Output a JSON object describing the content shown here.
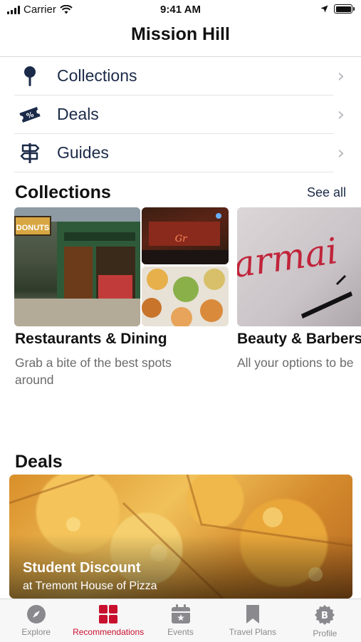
{
  "status": {
    "carrier": "Carrier",
    "time": "9:41 AM"
  },
  "nav": {
    "title": "Mission Hill"
  },
  "menu": [
    {
      "label": "Collections",
      "icon": "pin-icon"
    },
    {
      "label": "Deals",
      "icon": "ticket-icon"
    },
    {
      "label": "Guides",
      "icon": "signpost-icon"
    }
  ],
  "collections": {
    "title": "Collections",
    "see_all": "See all",
    "cards": [
      {
        "title": "Restaurants & Dining",
        "subtitle": "Grab a bite of the best spots around",
        "sign_text": "DONUTS"
      },
      {
        "title": "Beauty & Barbers",
        "subtitle": "All your options to be",
        "sign_text": "armai"
      }
    ]
  },
  "deals": {
    "title": "Deals",
    "card": {
      "title": "Student Discount",
      "subtitle": "at Tremont House of Pizza"
    }
  },
  "tabs": [
    {
      "label": "Explore",
      "icon": "compass-icon",
      "active": false
    },
    {
      "label": "Recommendations",
      "icon": "grid-icon",
      "active": true
    },
    {
      "label": "Events",
      "icon": "calendar-icon",
      "active": false
    },
    {
      "label": "Travel Plans",
      "icon": "bookmark-icon",
      "active": false
    },
    {
      "label": "Profile",
      "icon": "badge-icon",
      "active": false
    }
  ],
  "colors": {
    "accent": "#c8102e",
    "navy": "#1b2a48",
    "inactive": "#8a8a8e"
  }
}
